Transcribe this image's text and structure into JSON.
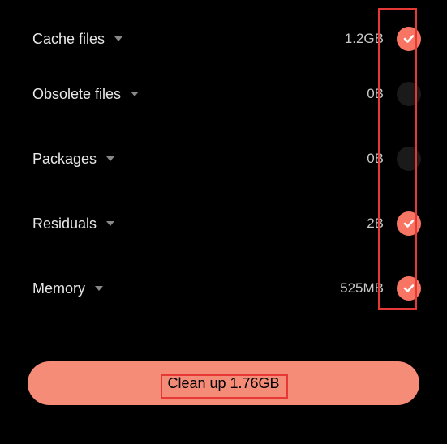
{
  "items": [
    {
      "label": "Cache files",
      "size": "1.2GB",
      "checked": true
    },
    {
      "label": "Obsolete files",
      "size": "0B",
      "checked": false
    },
    {
      "label": "Packages",
      "size": "0B",
      "checked": false
    },
    {
      "label": "Residuals",
      "size": "2B",
      "checked": true
    },
    {
      "label": "Memory",
      "size": "525MB",
      "checked": true
    }
  ],
  "cleanup_label": "Clean up 1.76GB"
}
